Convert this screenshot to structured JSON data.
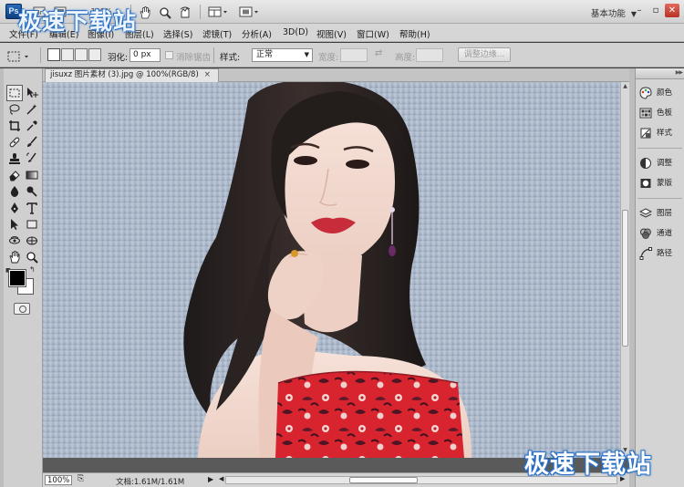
{
  "app": {
    "logo_text": "Ps",
    "zoom_display": "100%",
    "workspace_label": "基本功能",
    "window_controls": [
      "–",
      "▫",
      "✕"
    ]
  },
  "watermark": {
    "top": "极速下载站",
    "bottom": "极速下载站"
  },
  "menu": [
    "文件(F)",
    "编辑(E)",
    "图像(I)",
    "图层(L)",
    "选择(S)",
    "滤镜(T)",
    "分析(A)",
    "3D(D)",
    "视图(V)",
    "窗口(W)",
    "帮助(H)"
  ],
  "options": {
    "feather_label": "羽化:",
    "feather_value": "0 px",
    "antialias_label": "消除锯齿",
    "style_label": "样式:",
    "style_value": "正常",
    "width_label": "宽度:",
    "height_label": "高度:",
    "refine_edge_button": "调整边缘..."
  },
  "document": {
    "tab_title": "jisuxz 图片素材 (3).jpg @ 100%(RGB/8)",
    "tab_close": "×",
    "image_description": "Portrait photo of a woman with long dark hair wearing a red floral strapless dress against a blue-gray textured background"
  },
  "status": {
    "zoom": "100%",
    "doc_info": "文档:1.61M/1.61M"
  },
  "panels": [
    {
      "label": "颜色",
      "icon": "palette-icon"
    },
    {
      "label": "色板",
      "icon": "swatches-icon"
    },
    {
      "label": "样式",
      "icon": "styles-icon"
    },
    {
      "label": "调整",
      "icon": "adjustments-icon"
    },
    {
      "label": "蒙版",
      "icon": "masks-icon"
    },
    {
      "label": "图层",
      "icon": "layers-icon"
    },
    {
      "label": "通道",
      "icon": "channels-icon"
    },
    {
      "label": "路径",
      "icon": "paths-icon"
    }
  ],
  "colors": {
    "foreground": "#000000",
    "background": "#ffffff",
    "dress_red": "#d8242e",
    "backdrop": "#a9b6c8"
  }
}
